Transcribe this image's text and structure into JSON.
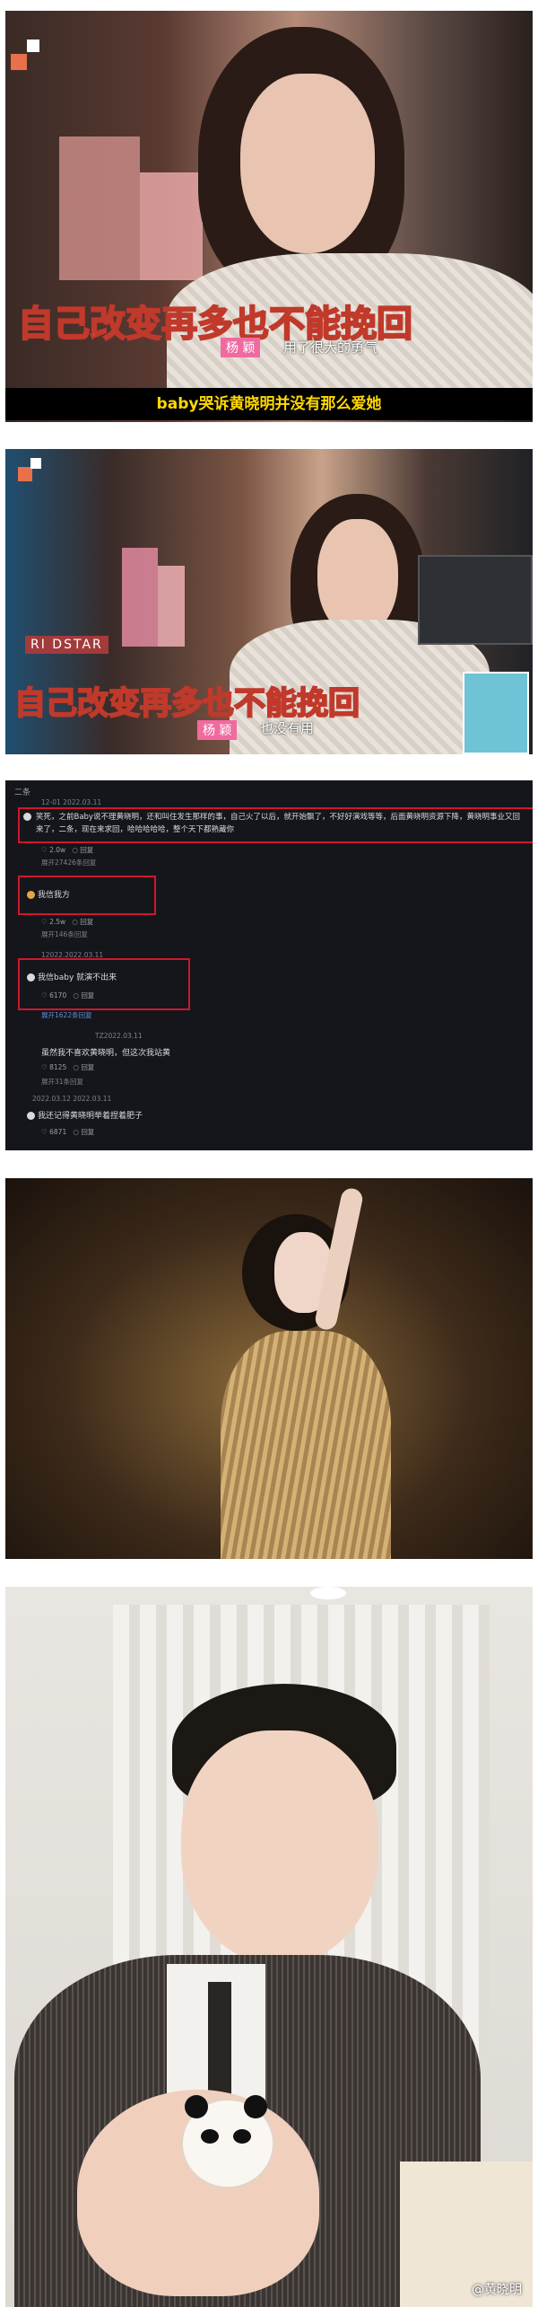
{
  "panel1": {
    "subtitle_big": "自己改变再多也不能挽回",
    "speaker_name": "杨  颖",
    "subtitle_small": "用了很大的勇气",
    "caption": "baby哭诉黄晓明并没有那么爱她"
  },
  "panel2": {
    "subtitle_big": "自己改变再多也不能挽回",
    "speaker_name": "杨  颖",
    "subtitle_small": "也没有用",
    "set_sign": "RI DSTAR"
  },
  "comments": {
    "header": "二条",
    "items": [
      {
        "meta": "12-01 2022.03.11",
        "text": "笑死，之前Baby说不理黄晓明，还和叫住发生那样的事，自己火了以后，就开始飘了，不好好演戏等等，后面黄晓明资源下降，黄晓明事业又回来了，二条，现在来求回，哈哈哈哈哈，整个天下都熟藏你",
        "likes": "2.0w",
        "reply_label": "回复",
        "more": "展开27426条回复"
      },
      {
        "meta": "",
        "text": "我信我方",
        "likes": "2.5w",
        "reply_label": "回复",
        "more": "展开146条回复"
      },
      {
        "meta": "12022.2022.03.11",
        "text": "我信baby 就演不出来",
        "likes": "6170",
        "reply_label": "回复",
        "more": "展开1622条回复"
      },
      {
        "meta": "TZ2022.03.11",
        "text": "虽然我不喜欢黄晓明，但这次我站黄",
        "likes": "8125",
        "reply_label": "回复",
        "more": "展开31条回复"
      },
      {
        "meta": "2022.03.12 2022.03.11",
        "text": "我还记得黄晓明举着捏着肥子",
        "likes": "6871",
        "reply_label": "回复",
        "more": ""
      }
    ]
  },
  "watermark": "@黄晓明",
  "colors": {
    "subtitle_fill": "#ffe14a",
    "subtitle_stroke": "#c0392b",
    "caption_text": "#ffd800",
    "highlight_box": "#d0162c",
    "name_tag": "#f06aa0"
  }
}
